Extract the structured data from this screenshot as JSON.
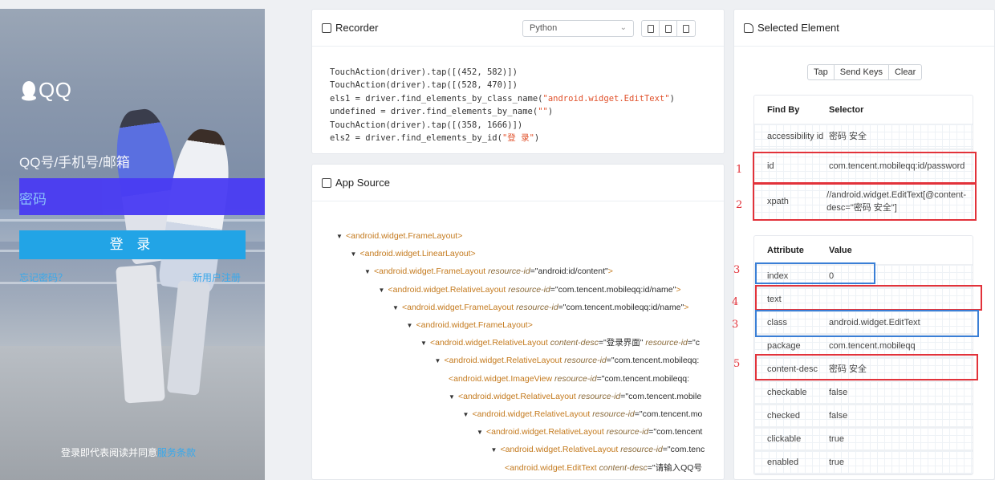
{
  "device": {
    "logo_text": "QQ",
    "account_placeholder": "QQ号/手机号/邮箱",
    "password_placeholder": "密码",
    "login_label": "登 录",
    "forgot_label": "忘记密码？",
    "register_label": "新用户注册",
    "agreement_text": "登录即代表阅读并同意",
    "agreement_link": "服务条款"
  },
  "recorder": {
    "title": "Recorder",
    "language": "Python",
    "code": [
      {
        "plain": "TouchAction(driver).tap([(452, 582)])"
      },
      {
        "plain": "TouchAction(driver).tap([(528, 470)])"
      },
      {
        "pre": "els1 = driver.find_elements_by_class_name(",
        "str": "\"android.widget.EditText\"",
        "post": ")"
      },
      {
        "pre": "undefined = driver.find_elements_by_name(",
        "str": "\"\"",
        "post": ")"
      },
      {
        "plain": "TouchAction(driver).tap([(358, 1666)])"
      },
      {
        "pre": "els2 = driver.find_elements_by_id(",
        "str": "\"登 录\"",
        "post": ")"
      }
    ]
  },
  "app_source": {
    "title": "App Source",
    "nodes": [
      {
        "depth": 0,
        "tri": true,
        "tag": "<android.widget.FrameLayout>",
        "attrs": []
      },
      {
        "depth": 1,
        "tri": true,
        "tag": "<android.widget.LinearLayout>",
        "attrs": []
      },
      {
        "depth": 2,
        "tri": true,
        "tag": "<android.widget.FrameLayout",
        "attrs": [
          {
            "k": "resource-id",
            "v": "\"android:id/content\""
          }
        ],
        "end": ">"
      },
      {
        "depth": 3,
        "tri": true,
        "tag": "<android.widget.RelativeLayout",
        "attrs": [
          {
            "k": "resource-id",
            "v": "\"com.tencent.mobileqq:id/name\""
          }
        ],
        "end": ">"
      },
      {
        "depth": 4,
        "tri": true,
        "tag": "<android.widget.FrameLayout",
        "attrs": [
          {
            "k": "resource-id",
            "v": "\"com.tencent.mobileqq:id/name\""
          }
        ],
        "end": ">"
      },
      {
        "depth": 5,
        "tri": true,
        "tag": "<android.widget.FrameLayout>",
        "attrs": []
      },
      {
        "depth": 6,
        "tri": true,
        "tag": "<android.widget.RelativeLayout",
        "attrs": [
          {
            "k": "content-desc",
            "v": "\"登录界面\""
          },
          {
            "k": "resource-id",
            "v": "\"c"
          }
        ],
        "end": ""
      },
      {
        "depth": 7,
        "tri": true,
        "tag": "<android.widget.RelativeLayout",
        "attrs": [
          {
            "k": "resource-id",
            "v": "\"com.tencent.mobileqq:"
          }
        ],
        "end": ""
      },
      {
        "depth": 8,
        "tri": false,
        "tag": "<android.widget.ImageView",
        "attrs": [
          {
            "k": "resource-id",
            "v": "\"com.tencent.mobileqq:"
          }
        ],
        "end": ""
      },
      {
        "depth": 8,
        "tri": true,
        "tag": "<android.widget.RelativeLayout",
        "attrs": [
          {
            "k": "resource-id",
            "v": "\"com.tencent.mobile"
          }
        ],
        "end": ""
      },
      {
        "depth": 9,
        "tri": true,
        "tag": "<android.widget.RelativeLayout",
        "attrs": [
          {
            "k": "resource-id",
            "v": "\"com.tencent.mo"
          }
        ],
        "end": ""
      },
      {
        "depth": 10,
        "tri": true,
        "tag": "<android.widget.RelativeLayout",
        "attrs": [
          {
            "k": "resource-id",
            "v": "\"com.tencent"
          }
        ],
        "end": ""
      },
      {
        "depth": 11,
        "tri": true,
        "tag": "<android.widget.RelativeLayout",
        "attrs": [
          {
            "k": "resource-id",
            "v": "\"com.tenc"
          }
        ],
        "end": ""
      },
      {
        "depth": 12,
        "tri": false,
        "tag": "<android.widget.EditText",
        "attrs": [
          {
            "k": "content-desc",
            "v": "\"请输入QQ号"
          }
        ],
        "end": ""
      }
    ]
  },
  "selected": {
    "title": "Selected Element",
    "actions": [
      "Tap",
      "Send Keys",
      "Clear"
    ],
    "find_by": {
      "headers": [
        "Find By",
        "Selector"
      ],
      "rows": [
        {
          "key": "accessibility id",
          "value": "密码 安全"
        },
        {
          "key": "id",
          "value": "com.tencent.mobileqq:id/password"
        },
        {
          "key": "xpath",
          "value": "//android.widget.EditText[@content-desc=\"密码 安全\"]"
        }
      ]
    },
    "attributes": {
      "headers": [
        "Attribute",
        "Value"
      ],
      "rows": [
        {
          "key": "index",
          "value": "0"
        },
        {
          "key": "text",
          "value": ""
        },
        {
          "key": "class",
          "value": "android.widget.EditText"
        },
        {
          "key": "package",
          "value": "com.tencent.mobileqq"
        },
        {
          "key": "content-desc",
          "value": "密码 安全"
        },
        {
          "key": "checkable",
          "value": "false"
        },
        {
          "key": "checked",
          "value": "false"
        },
        {
          "key": "clickable",
          "value": "true"
        },
        {
          "key": "enabled",
          "value": "true"
        }
      ]
    }
  },
  "annotations": [
    "1",
    "2",
    "3",
    "4",
    "3",
    "5"
  ],
  "colors": {
    "accent_red": "#e2323a",
    "accent_blue": "#3a7fd6",
    "login_blue": "#22a4e6",
    "highlight": "#4a3cf2"
  }
}
